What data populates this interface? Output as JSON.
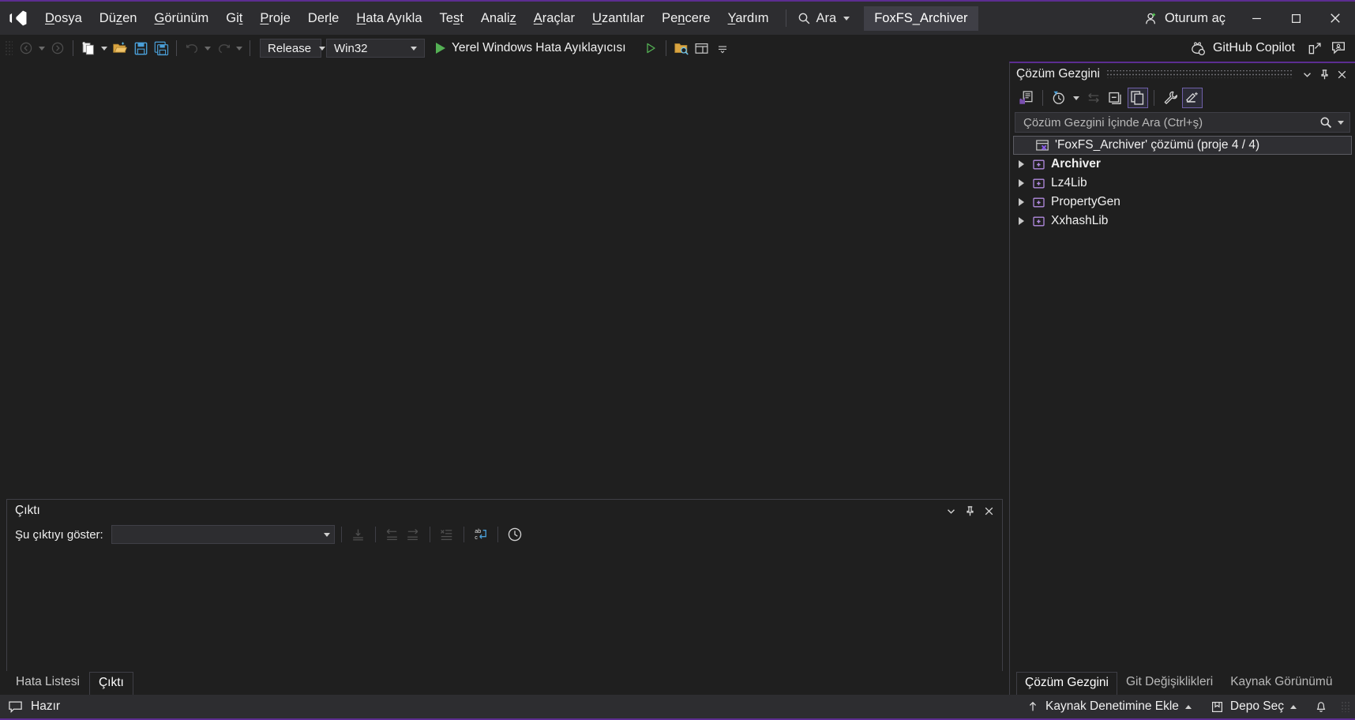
{
  "app": {
    "name": "Microsoft Visual Studio",
    "accent_purple": "#5c2d91",
    "bg": "#1f1f1f",
    "chrome_bg": "#2d2d30"
  },
  "titlebar": {
    "logo_icon": "visual-studio-logo-icon",
    "menus": [
      {
        "label": "Dosya",
        "mnemonic": "D"
      },
      {
        "label": "Düzen",
        "mnemonic": "z"
      },
      {
        "label": "Görünüm",
        "mnemonic": "G"
      },
      {
        "label": "Git",
        "mnemonic": "t"
      },
      {
        "label": "Proje",
        "mnemonic": "P"
      },
      {
        "label": "Derle",
        "mnemonic": "l"
      },
      {
        "label": "Hata Ayıkla",
        "mnemonic": "H"
      },
      {
        "label": "Test",
        "mnemonic": "s"
      },
      {
        "label": "Analiz",
        "mnemonic": "z"
      },
      {
        "label": "Araçlar",
        "mnemonic": "A"
      },
      {
        "label": "Uzantılar",
        "mnemonic": "U"
      },
      {
        "label": "Pencere",
        "mnemonic": "n"
      },
      {
        "label": "Yardım",
        "mnemonic": "Y"
      }
    ],
    "search_label": "Ara",
    "search_icon": "search-icon",
    "project_chip": "FoxFS_Archiver",
    "signin_label": "Oturum aç",
    "signin_icon": "add-user-icon",
    "window_minimize_icon": "minimize-icon",
    "window_maximize_icon": "maximize-icon",
    "window_close_icon": "close-icon"
  },
  "toolbar": {
    "back_icon": "navigate-back-icon",
    "forward_icon": "navigate-forward-icon",
    "new_item_icon": "new-item-icon",
    "open_icon": "open-folder-icon",
    "save_icon": "save-icon",
    "save_all_icon": "save-all-icon",
    "undo_icon": "undo-icon",
    "redo_icon": "redo-icon",
    "configuration": "Release",
    "platform": "Win32",
    "run_label": "Yerel Windows Hata Ayıklayıcısı",
    "run_icon": "run-play-icon",
    "run_dropdown_icon": "chevron-down-icon",
    "start_no_debug_icon": "start-without-debugging-icon",
    "find_in_files_icon": "folder-search-icon",
    "window_layout_icon": "window-layout-icon",
    "more_icon": "overflow-more-icon",
    "copilot_label": "GitHub Copilot",
    "copilot_icon": "github-copilot-icon",
    "share_icon": "share-icon",
    "feedback_icon": "feedback-icon"
  },
  "output_pane": {
    "title": "Çıktı",
    "dropdown_icon": "chevron-down-icon",
    "pin_icon": "pin-icon",
    "close_icon": "close-icon",
    "show_output_label": "Şu çıktıyı göster:",
    "show_output_value": "",
    "combo_arrow_icon": "chevron-down-icon",
    "buttons": [
      {
        "name": "go-to-message-icon",
        "enabled": false
      },
      {
        "name": "previous-message-icon",
        "enabled": false
      },
      {
        "name": "next-message-icon",
        "enabled": false
      },
      {
        "name": "clear-all-icon",
        "enabled": false
      },
      {
        "name": "toggle-word-wrap-icon",
        "enabled": true
      },
      {
        "name": "toggle-timestamp-icon",
        "enabled": true
      }
    ],
    "content": ""
  },
  "bottom_tabs": {
    "items": [
      {
        "label": "Hata Listesi",
        "active": false
      },
      {
        "label": "Çıktı",
        "active": true
      }
    ]
  },
  "solution_explorer": {
    "title": "Çözüm Gezgini",
    "dropdown_icon": "chevron-down-icon",
    "pin_icon": "pin-icon",
    "close_icon": "close-icon",
    "toolbar": [
      {
        "name": "code-view-icon",
        "toggled": false,
        "enabled": true
      },
      {
        "name": "pending-changes-filter-icon",
        "toggled": false,
        "enabled": true
      },
      {
        "name": "sync-with-active-document-icon",
        "toggled": false,
        "enabled": false
      },
      {
        "name": "collapse-all-icon",
        "toggled": false,
        "enabled": true
      },
      {
        "name": "show-all-files-icon",
        "toggled": true,
        "enabled": true
      },
      {
        "name": "properties-icon",
        "toggled": false,
        "enabled": true
      },
      {
        "name": "preview-selected-items-icon",
        "toggled": true,
        "enabled": true
      }
    ],
    "search_placeholder": "Çözüm Gezgini İçinde Ara (Ctrl+ş)",
    "search_value": "",
    "search_icon": "search-icon",
    "search_dropdown_icon": "chevron-down-icon",
    "tree": [
      {
        "label": "'FoxFS_Archiver' çözümü (proje 4 / 4)",
        "icon": "solution-icon",
        "level": 0,
        "selected": true,
        "bold": false,
        "has_arrow": false
      },
      {
        "label": "Archiver",
        "icon": "cpp-project-icon",
        "level": 1,
        "selected": false,
        "bold": true,
        "has_arrow": true
      },
      {
        "label": "Lz4Lib",
        "icon": "cpp-project-icon",
        "level": 1,
        "selected": false,
        "bold": false,
        "has_arrow": true
      },
      {
        "label": "PropertyGen",
        "icon": "cpp-project-icon",
        "level": 1,
        "selected": false,
        "bold": false,
        "has_arrow": true
      },
      {
        "label": "XxhashLib",
        "icon": "cpp-project-icon",
        "level": 1,
        "selected": false,
        "bold": false,
        "has_arrow": true
      }
    ],
    "bottom_tabs": [
      {
        "label": "Çözüm Gezgini",
        "active": true
      },
      {
        "label": "Git Değişiklikleri",
        "active": false
      },
      {
        "label": "Kaynak Görünümü",
        "active": false
      }
    ]
  },
  "statusbar": {
    "ready_icon": "status-ready-icon",
    "ready_label": "Hazır",
    "add_to_source_control_label": "Kaynak Denetimine Ekle",
    "add_to_source_control_icon": "arrow-up-icon",
    "add_to_source_control_caret": "caret-up-icon",
    "select_repository_label": "Depo Seç",
    "select_repository_icon": "repository-icon",
    "select_repository_caret": "caret-up-icon",
    "notifications_icon": "bell-icon",
    "resize_grip_icon": "resize-grip-icon"
  }
}
